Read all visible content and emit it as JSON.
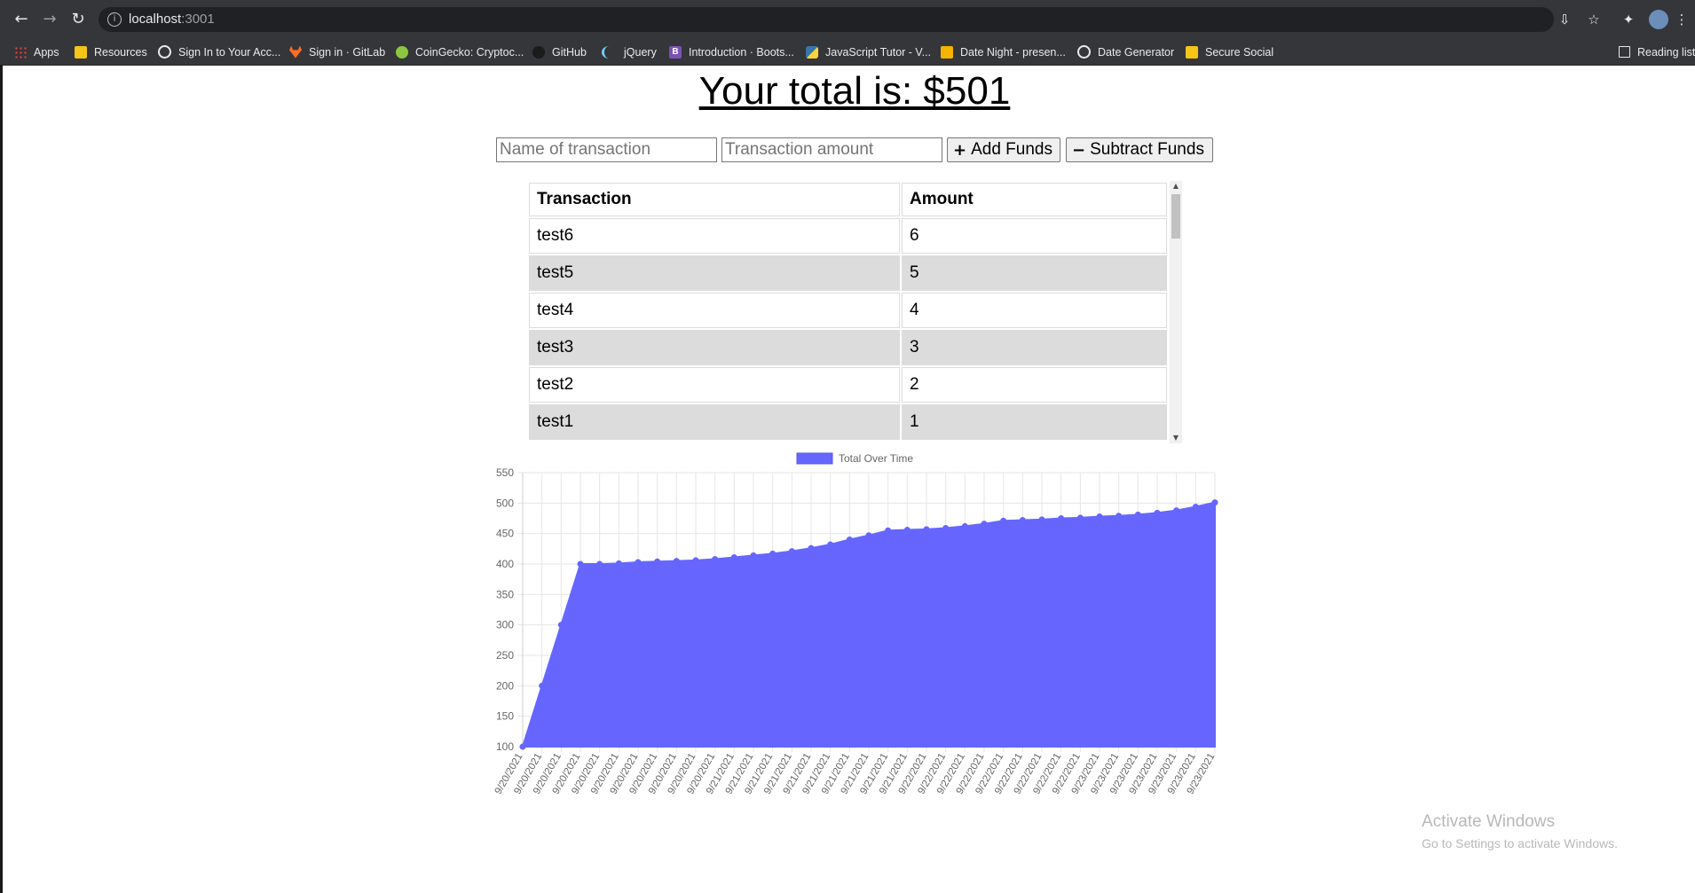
{
  "browser": {
    "url_host": "localhost",
    "url_port": ":3001",
    "bookmarks": [
      {
        "label": "Apps",
        "icon": "apps-grid-icon"
      },
      {
        "label": "Resources",
        "icon": "folder-icon"
      },
      {
        "label": "Sign In to Your Acc...",
        "icon": "globe-icon"
      },
      {
        "label": "Sign in · GitLab",
        "icon": "gitlab-icon"
      },
      {
        "label": "CoinGecko: Cryptoc...",
        "icon": "coingecko-icon"
      },
      {
        "label": "GitHub",
        "icon": "github-icon"
      },
      {
        "label": "jQuery",
        "icon": "jquery-icon"
      },
      {
        "label": "Introduction · Boots...",
        "icon": "bootstrap-icon"
      },
      {
        "label": "JavaScript Tutor - V...",
        "icon": "python-icon"
      },
      {
        "label": "Date Night - presen...",
        "icon": "slides-icon"
      },
      {
        "label": "Date Generator",
        "icon": "globe-icon"
      },
      {
        "label": "Secure Social",
        "icon": "folder-icon"
      }
    ],
    "reading_list": "Reading list"
  },
  "page": {
    "title": "Your total is: $501",
    "name_placeholder": "Name of transaction",
    "amount_placeholder": "Transaction amount",
    "add_label": "Add Funds",
    "subtract_label": "Subtract Funds",
    "add_symbol": "+",
    "subtract_symbol": "−"
  },
  "table": {
    "headers": [
      "Transaction",
      "Amount"
    ],
    "rows": [
      [
        "test6",
        "6"
      ],
      [
        "test5",
        "5"
      ],
      [
        "test4",
        "4"
      ],
      [
        "test3",
        "3"
      ],
      [
        "test2",
        "2"
      ],
      [
        "test1",
        "1"
      ]
    ]
  },
  "chart_data": {
    "type": "area",
    "legend": "Total Over Time",
    "legend_position": "top",
    "fill_color": "#6666ff",
    "grid": true,
    "ylim": [
      100,
      550
    ],
    "yticks": [
      100,
      150,
      200,
      250,
      300,
      350,
      400,
      450,
      500,
      550
    ],
    "x": [
      "9/20/2021",
      "9/20/2021",
      "9/20/2021",
      "9/20/2021",
      "9/20/2021",
      "9/20/2021",
      "9/20/2021",
      "9/20/2021",
      "9/20/2021",
      "9/20/2021",
      "9/20/2021",
      "9/21/2021",
      "9/21/2021",
      "9/21/2021",
      "9/21/2021",
      "9/21/2021",
      "9/21/2021",
      "9/21/2021",
      "9/21/2021",
      "9/21/2021",
      "9/21/2021",
      "9/22/2021",
      "9/22/2021",
      "9/22/2021",
      "9/22/2021",
      "9/22/2021",
      "9/22/2021",
      "9/22/2021",
      "9/22/2021",
      "9/22/2021",
      "9/23/2021",
      "9/23/2021",
      "9/23/2021",
      "9/23/2021",
      "9/23/2021",
      "9/23/2021",
      "9/23/2021"
    ],
    "values": [
      100,
      200,
      300,
      400,
      400,
      401,
      403,
      404,
      405,
      406,
      408,
      411,
      414,
      417,
      421,
      426,
      432,
      440,
      447,
      455,
      456,
      457,
      459,
      462,
      466,
      471,
      472,
      473,
      475,
      476,
      478,
      479,
      481,
      484,
      488,
      494,
      501
    ]
  },
  "watermark": {
    "line1": "Activate Windows",
    "line2": "Go to Settings to activate Windows."
  }
}
